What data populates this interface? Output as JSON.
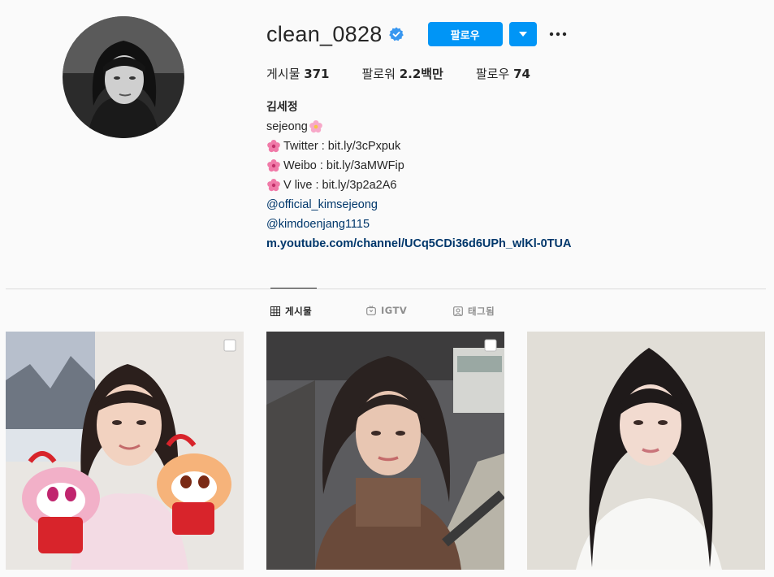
{
  "profile": {
    "username": "clean_0828",
    "verified": true,
    "follow_label": "팔로우",
    "stats": {
      "posts_label": "게시물",
      "posts_value": "371",
      "followers_label": "팔로워",
      "followers_value": "2.2백만",
      "following_label": "팔로우",
      "following_value": "74"
    },
    "bio": {
      "name": "김세정",
      "line1": "sejeong",
      "twitter": "Twitter : bit.ly/3cPxpuk",
      "weibo": "Weibo : bit.ly/3aMWFip",
      "vlive": "V live : bit.ly/3p2a2A6",
      "mention1": "@official_kimsejeong",
      "mention2": "@kimdoenjang1115",
      "link": "m.youtube.com/channel/UCq5CDi36d6UPh_wlKl-0TUA"
    }
  },
  "tabs": [
    {
      "label": "게시물",
      "icon": "grid-icon",
      "active": true
    },
    {
      "label": "IGTV",
      "icon": "igtv-icon",
      "active": false
    },
    {
      "label": "태그됨",
      "icon": "tagged-icon",
      "active": false
    }
  ],
  "posts": [
    {
      "icon": "multi-post-icon",
      "multi": true
    },
    {
      "icon": "multi-post-icon",
      "multi": true
    },
    {
      "icon": "",
      "multi": false
    }
  ],
  "colors": {
    "accent": "#0095f6",
    "link": "#00376b",
    "text": "#262626",
    "muted": "#8e8e8e",
    "background": "#fafafa"
  }
}
